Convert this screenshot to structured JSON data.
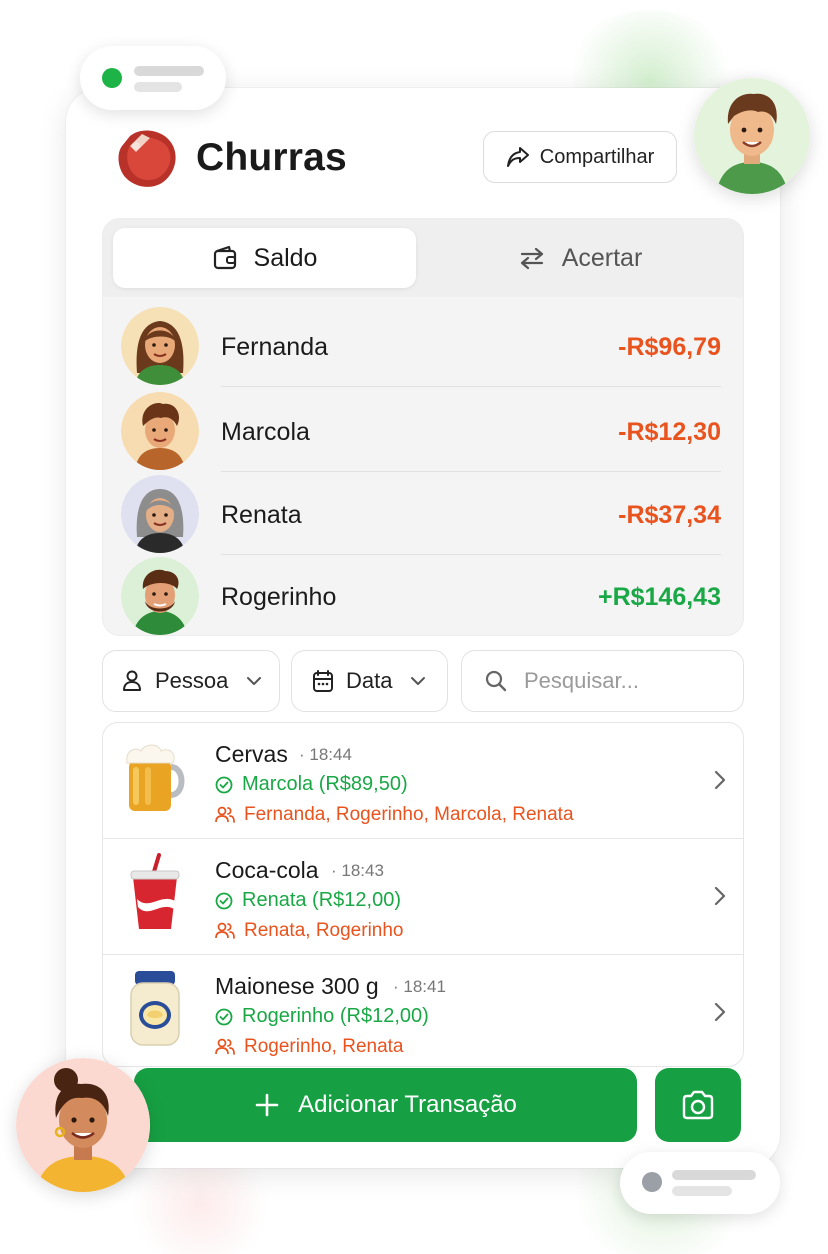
{
  "app": {
    "title": "Churras",
    "share_label": "Compartilhar"
  },
  "tabs": [
    {
      "label": "Saldo",
      "icon": "wallet-icon",
      "active": true
    },
    {
      "label": "Acertar",
      "icon": "swap-arrows-icon",
      "active": false
    }
  ],
  "balances": [
    {
      "name": "Fernanda",
      "amount": "-R$96,79",
      "sign": "negative"
    },
    {
      "name": "Marcola",
      "amount": "-R$12,30",
      "sign": "negative"
    },
    {
      "name": "Renata",
      "amount": "-R$37,34",
      "sign": "negative"
    },
    {
      "name": "Rogerinho",
      "amount": "+R$146,43",
      "sign": "positive"
    }
  ],
  "filters": {
    "person_label": "Pessoa",
    "date_label": "Data",
    "search_placeholder": "Pesquisar..."
  },
  "transactions": [
    {
      "name": "Cervas",
      "time": "18:44",
      "payer": "Marcola (R$89,50)",
      "participants": "Fernanda, Rogerinho, Marcola, Renata",
      "icon": "beer-mug-icon"
    },
    {
      "name": "Coca-cola",
      "time": "18:43",
      "payer": "Renata (R$12,00)",
      "participants": "Renata, Rogerinho",
      "icon": "soda-cup-icon"
    },
    {
      "name": "Maionese 300 g",
      "time": "18:41",
      "payer": "Rogerinho (R$12,00)",
      "participants": "Rogerinho, Renata",
      "icon": "mayonnaise-jar-icon"
    }
  ],
  "actions": {
    "add_label": "Adicionar Transação",
    "camera_icon": "camera-icon"
  },
  "colors": {
    "primary_green": "#17a043",
    "positive": "#1aa846",
    "negative": "#e8531e"
  }
}
